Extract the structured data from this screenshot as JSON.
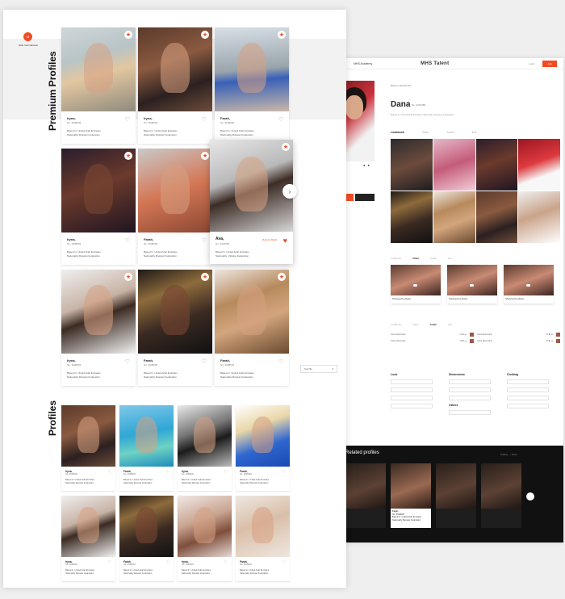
{
  "front": {
    "logo_initial": "M",
    "logo_text": "Elite International",
    "premium_title": "Premium Profiles",
    "profiles_title": "Profiles",
    "sort_label": "Sort By",
    "premium_cards": [
      {
        "name": "Iryna,",
        "no": "No. 3948693",
        "based": "Based in: United Arab Emirates",
        "nat": "Nationality:Russian Federation"
      },
      {
        "name": "Iryna,",
        "no": "No. 3948693",
        "based": "Based in: United Arab Emirates",
        "nat": "Nationality:Russian Federation"
      },
      {
        "name": "Farah,",
        "no": "No. 3948693",
        "based": "Based in: United Arab Emirates",
        "nat": "Nationality:Russian Federation"
      },
      {
        "name": "Iryna,",
        "no": "No. 3948693",
        "based": "Based in: United Arab Emirates",
        "nat": "Nationality:Russian Federation"
      },
      {
        "name": "Farah,",
        "no": "No. 3948693",
        "based": "Based in: United Arab Emirates",
        "nat": "Nationality:Russian Federation"
      },
      {
        "name": "Ava,",
        "no": "No. 2342359",
        "based": "Based in: United Arab Emirates",
        "nat": "Nationality: Ukraine Federation",
        "book": "Book for Model"
      },
      {
        "name": "Iryna,",
        "no": "No. 3948693",
        "based": "Based in: United Arab Emirates",
        "nat": "Nationality:Russian Federation"
      },
      {
        "name": "Farah,",
        "no": "No. 3948693",
        "based": "Based in: United Arab Emirates",
        "nat": "Nationality:Russian Federation"
      },
      {
        "name": "Farah,",
        "no": "No. 3948693",
        "based": "Based in: United Arab Emirates",
        "nat": "Nationality:Russian Federation"
      }
    ],
    "profile_cards": [
      {
        "name": "Iryna,",
        "no": "No. 3948693",
        "based": "Based in: United Arab Emirates",
        "nat": "Nationality:Russian Federation"
      },
      {
        "name": "Farah,",
        "no": "No. 3948693",
        "based": "Based in: United Arab Emirates",
        "nat": "Nationality:Russian Federation"
      },
      {
        "name": "Iryna,",
        "no": "No. 3948693",
        "based": "Based in: United Arab Emirates",
        "nat": "Nationality:Russian Federation"
      },
      {
        "name": "Farah,",
        "no": "No. 3948693",
        "based": "Based in: United Arab Emirates",
        "nat": "Nationality:Russian Federation"
      },
      {
        "name": "Iryna,",
        "no": "No. 3948693",
        "based": "Based in: United Arab Emirates",
        "nat": "Nationality:Russian Federation"
      },
      {
        "name": "Farah,",
        "no": "No. 3948693",
        "based": "Based in: United Arab Emirates",
        "nat": "Nationality:Russian Federation"
      },
      {
        "name": "Iryna,",
        "no": "No. 3948693",
        "based": "Based in: United Arab Emirates",
        "nat": "Nationality:Russian Federation"
      },
      {
        "name": "Farah,",
        "no": "No. 3948693",
        "based": "Based in: United Arab Emirates",
        "nat": "Nationality:Russian Federation"
      }
    ]
  },
  "detail": {
    "nav_item": "MHS Academy",
    "brand": "MHS Talent",
    "login": "Login",
    "join": "Join",
    "back": "Back to Models list",
    "name": "Dana",
    "no": "No. 2019384",
    "meta": "Based in: United Arab Emirates   Nationality: Russian Federation",
    "tabs": [
      "Lookbook",
      "Video",
      "Audio",
      "Info"
    ],
    "video_tabs": [
      "Lookbook",
      "Video",
      "Audio",
      "Info"
    ],
    "audio_tabs": [
      "Lookbook",
      "Video",
      "Audio",
      "Info"
    ],
    "video_caption": "Showreel by Dana",
    "audio_label": "Voice Recorded",
    "stats_titles": [
      "Look",
      "Dimensions",
      "Clothing"
    ],
    "others_title": "Others",
    "related_title": "Related profiles",
    "related_nav": "Gallery → Next",
    "related_card": {
      "name": "Farah,",
      "no": "No. 3948693",
      "based": "Based in: United Arab Emirates",
      "nat": "Nationality:Russian Federation"
    }
  },
  "colors": {
    "accent": "#f04b23"
  }
}
